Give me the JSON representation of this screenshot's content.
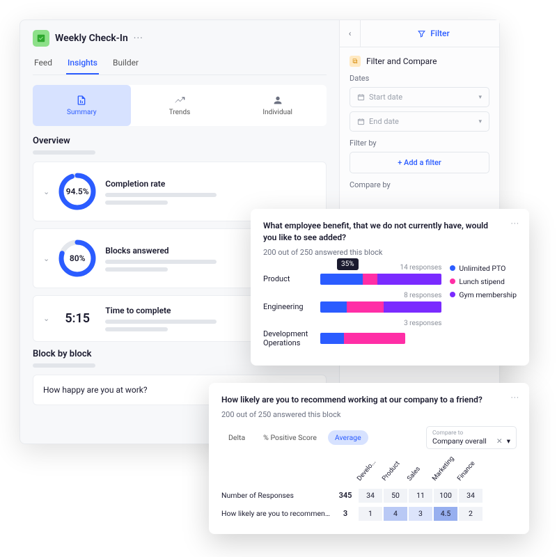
{
  "header": {
    "title": "Weekly Check-In"
  },
  "tabs": [
    "Feed",
    "Insights",
    "Builder"
  ],
  "active_tab": "Insights",
  "segments": [
    {
      "label": "Summary",
      "icon": "summary-icon",
      "active": true
    },
    {
      "label": "Trends",
      "icon": "trends-icon",
      "active": false
    },
    {
      "label": "Individual",
      "icon": "individual-icon",
      "active": false
    }
  ],
  "overview": {
    "title": "Overview",
    "stats": [
      {
        "label": "Completion rate",
        "value": "94.5%",
        "pct": 94.5,
        "type": "ring"
      },
      {
        "label": "Blocks answered",
        "value": "80%",
        "pct": 80,
        "type": "ring"
      },
      {
        "label": "Time to complete",
        "value": "5:15",
        "type": "time"
      }
    ]
  },
  "block_by_block": {
    "title": "Block by block",
    "first_question": "How happy are you at work?"
  },
  "right_panel": {
    "filter_label": "Filter",
    "section_title": "Filter and Compare",
    "dates_label": "Dates",
    "start_placeholder": "Start date",
    "end_placeholder": "End date",
    "filter_by_label": "Filter by",
    "add_filter_label": "+  Add a filter",
    "compare_by_label": "Compare by"
  },
  "benefit_card": {
    "question": "What employee benefit, that we do not currently have, would you like to see added?",
    "subtitle": "200 out of 250 answered this block",
    "tooltip": "35%",
    "rows": [
      {
        "label": "Product",
        "responses": "14 responses",
        "segs": [
          35,
          12,
          53
        ]
      },
      {
        "label": "Engineering",
        "responses": "8 responses",
        "segs": [
          22,
          30,
          48
        ]
      },
      {
        "label": "Development Operations",
        "responses": "3 responses",
        "segs": [
          28,
          72,
          0
        ]
      }
    ],
    "legend": [
      {
        "color": "#2b5cff",
        "label": "Unlimited PTO"
      },
      {
        "color": "#ff2ea6",
        "label": "Lunch stipend"
      },
      {
        "color": "#7a2bff",
        "label": "Gym membership"
      }
    ]
  },
  "recommend_card": {
    "question": "How likely are you to recommend working at our company to a friend?",
    "subtitle": "200 out of 250 answered this block",
    "chips": [
      "Delta",
      "% Positive Score",
      "Average"
    ],
    "active_chip": "Average",
    "compare_to_label": "Compare to",
    "compare_to_value": "Company overall",
    "columns": [
      "Develo...",
      "Product",
      "Sales",
      "Marketing",
      "Finance"
    ],
    "rows": [
      {
        "label": "Number of Responses",
        "first": "345",
        "cells": [
          "34",
          "50",
          "11",
          "100",
          "34"
        ],
        "shades": [
          0,
          0,
          0,
          0,
          0
        ]
      },
      {
        "label": "How likely are you to recommend...",
        "first": "3",
        "cells": [
          "1",
          "4",
          "3",
          "4.5",
          "2"
        ],
        "shades": [
          0,
          2,
          1,
          3,
          0
        ]
      }
    ]
  },
  "chart_data": [
    {
      "type": "bar",
      "title": "What employee benefit, that we do not currently have, would you like to see added?",
      "orientation": "horizontal-stacked",
      "categories": [
        "Product",
        "Engineering",
        "Development Operations"
      ],
      "response_counts": [
        14,
        8,
        3
      ],
      "series": [
        {
          "name": "Unlimited PTO",
          "color": "#2b5cff",
          "values": [
            35,
            22,
            28
          ]
        },
        {
          "name": "Lunch stipend",
          "color": "#ff2ea6",
          "values": [
            12,
            30,
            72
          ]
        },
        {
          "name": "Gym membership",
          "color": "#7a2bff",
          "values": [
            53,
            48,
            0
          ]
        }
      ],
      "xlabel": "",
      "ylabel": "",
      "unit": "percent"
    },
    {
      "type": "heatmap",
      "title": "How likely are you to recommend working at our company to a friend?",
      "metric": "Average",
      "columns": [
        "Develo...",
        "Product",
        "Sales",
        "Marketing",
        "Finance"
      ],
      "rows": [
        {
          "label": "Number of Responses",
          "overall": 345,
          "values": [
            34,
            50,
            11,
            100,
            34
          ]
        },
        {
          "label": "How likely are you to recommend...",
          "overall": 3,
          "values": [
            1,
            4,
            3,
            4.5,
            2
          ]
        }
      ]
    }
  ]
}
